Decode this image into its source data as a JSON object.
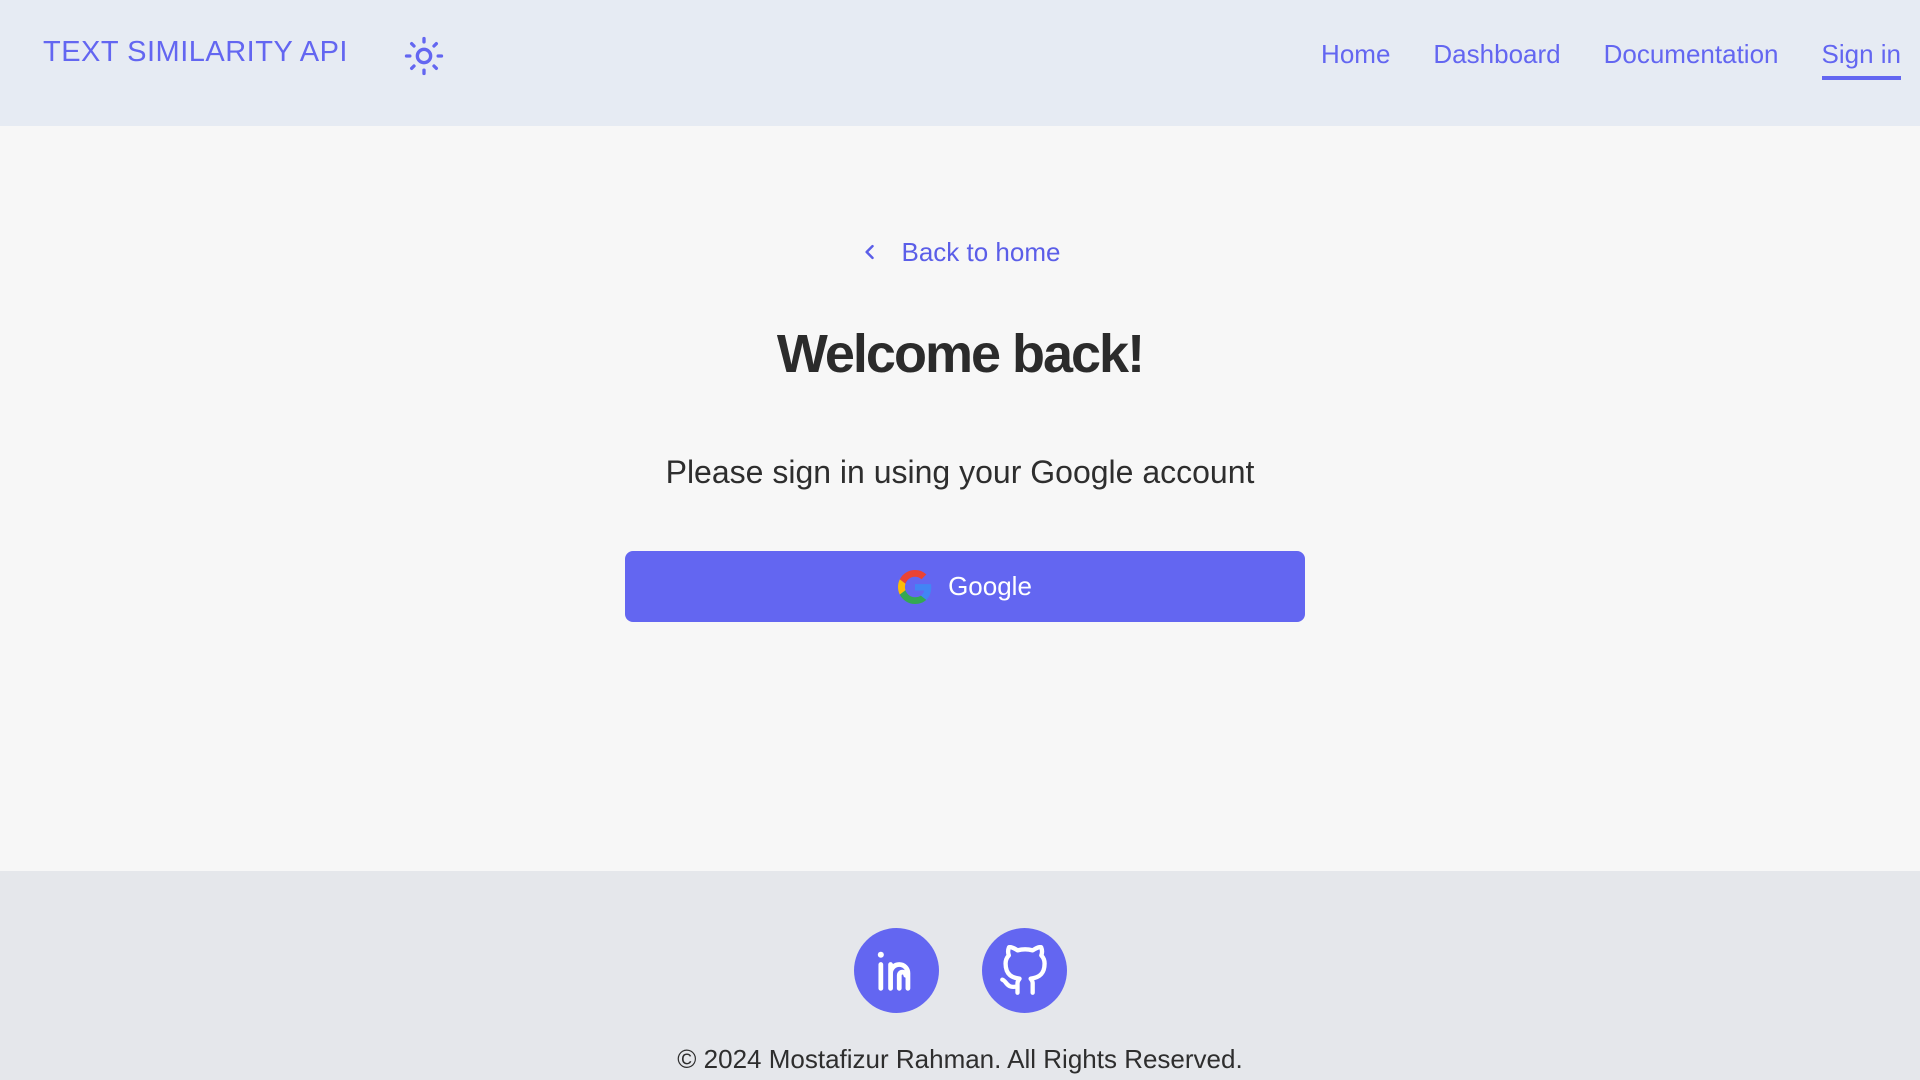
{
  "navbar": {
    "brand": "TEXT SIMILARITY API",
    "theme_icon": "sun-icon",
    "links": [
      {
        "label": "Home"
      },
      {
        "label": "Dashboard"
      },
      {
        "label": "Documentation"
      },
      {
        "label": "Sign in",
        "active": true
      }
    ]
  },
  "main": {
    "back_link": "Back to home",
    "title": "Welcome back!",
    "subtitle": "Please sign in using your Google account",
    "google_button": "Google"
  },
  "footer": {
    "socials": [
      {
        "icon": "linkedin-icon"
      },
      {
        "icon": "github-icon"
      }
    ],
    "copyright": "© 2024 Mostafizur Rahman. All Rights Reserved."
  },
  "colors": {
    "accent": "#6366f1",
    "navbar_bg": "#e6ebf3",
    "main_bg": "#f7f7f7",
    "footer_bg": "#e5e7eb",
    "text": "#2b2b2b"
  }
}
